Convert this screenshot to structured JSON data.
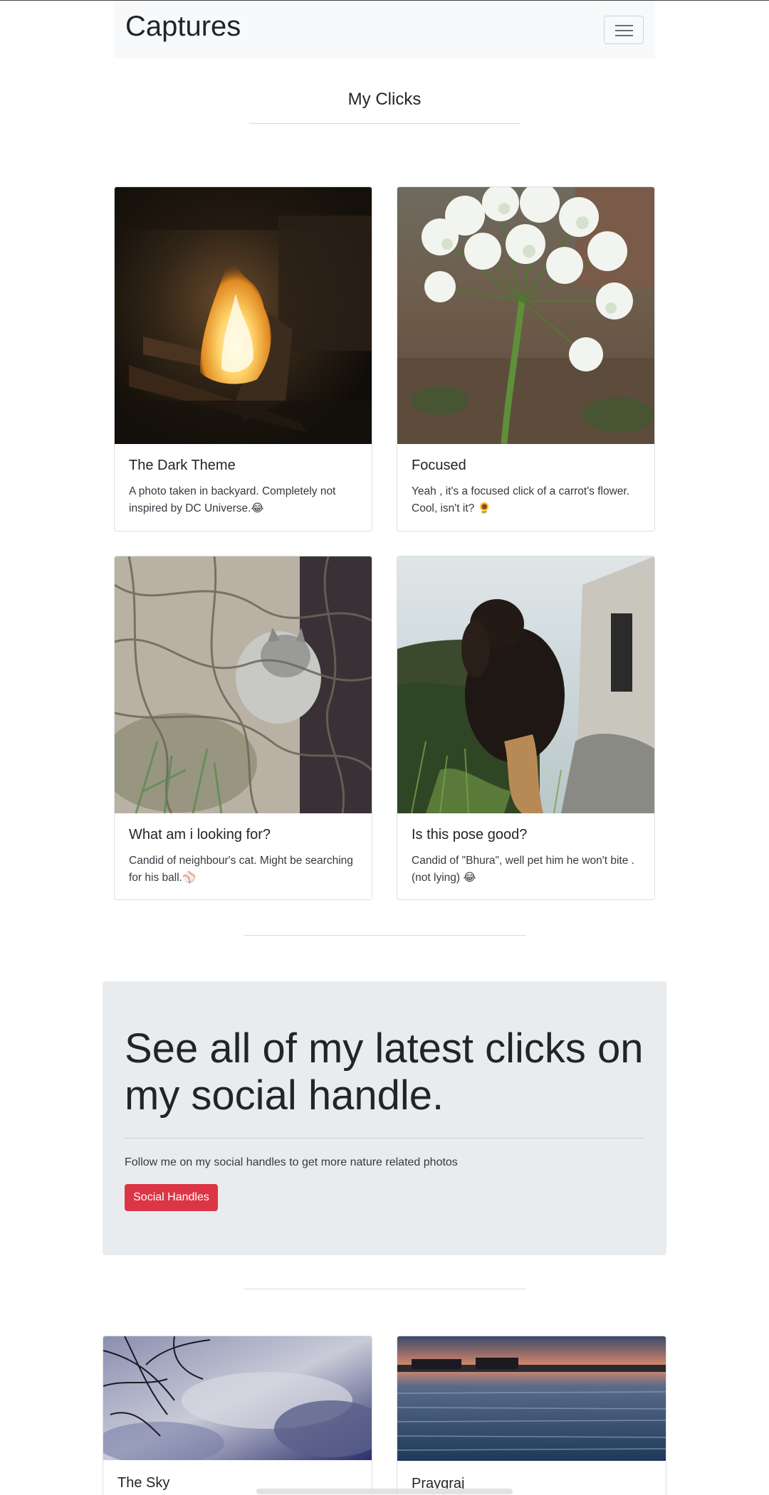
{
  "navbar": {
    "brand": "Captures",
    "toggle_label": "Toggle navigation"
  },
  "section": {
    "title": "My Clicks"
  },
  "cards": [
    {
      "title": "The Dark Theme",
      "text": "A photo taken in backyard. Completely not inspired by DC Universe.😂",
      "image": "campfire-photo"
    },
    {
      "title": "Focused",
      "text": "Yeah , it's a focused click of a carrot's flower. Cool, isn't it? 🌻",
      "image": "white-flower-photo"
    },
    {
      "title": "What am i looking for?",
      "text": "Candid of neighbour's cat. Might be searching for his ball.⚾",
      "image": "cat-in-bushes-photo"
    },
    {
      "title": "Is this pose good?",
      "text": "Candid of \"Bhura\", well pet him he won't bite . (not lying) 😂",
      "image": "dog-photo"
    }
  ],
  "jumbotron": {
    "heading": "See all of my latest clicks on my social handle.",
    "lead": "Follow me on my social handles to get more nature related photos",
    "button_label": "Social Handles",
    "button_color": "#dc3545"
  },
  "bottom_cards": [
    {
      "title": "The Sky",
      "image": "sky-photo"
    },
    {
      "title": "Praygraj",
      "image": "river-sunset-photo"
    }
  ]
}
